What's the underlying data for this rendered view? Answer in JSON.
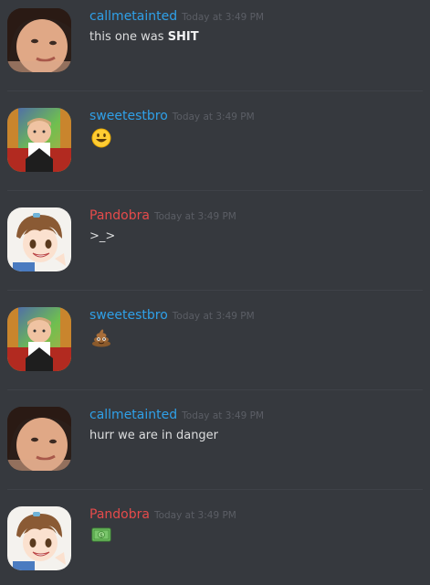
{
  "messages": [
    {
      "username": "callmetainted",
      "timestamp": "Today at 3:49 PM",
      "text": "this one was ",
      "bold": "SHIT",
      "color": "#2fa0e8",
      "avatar": "woman-avatar"
    },
    {
      "username": "sweetestbro",
      "timestamp": "Today at 3:49 PM",
      "emoji": "smiley-emoji",
      "color": "#2fa0e8",
      "avatar": "boy-avatar"
    },
    {
      "username": "Pandobra",
      "timestamp": "Today at 3:49 PM",
      "text": ">_>",
      "color": "#e64b4b",
      "avatar": "anime-girl-avatar"
    },
    {
      "username": "sweetestbro",
      "timestamp": "Today at 3:49 PM",
      "emoji": "poop-emoji",
      "color": "#2fa0e8",
      "avatar": "boy-avatar"
    },
    {
      "username": "callmetainted",
      "timestamp": "Today at 3:49 PM",
      "text": "hurr we are in danger",
      "color": "#2fa0e8",
      "avatar": "woman-avatar"
    },
    {
      "username": "Pandobra",
      "timestamp": "Today at 3:49 PM",
      "emoji": "dollar-bill-emoji",
      "color": "#e64b4b",
      "avatar": "anime-girl-avatar"
    }
  ]
}
